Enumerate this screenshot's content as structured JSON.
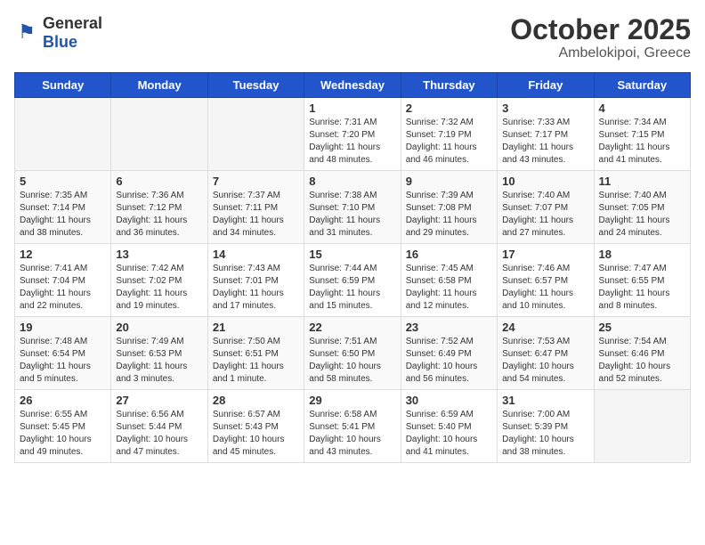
{
  "header": {
    "logo_general": "General",
    "logo_blue": "Blue",
    "title": "October 2025",
    "subtitle": "Ambelokipoi, Greece"
  },
  "weekdays": [
    "Sunday",
    "Monday",
    "Tuesday",
    "Wednesday",
    "Thursday",
    "Friday",
    "Saturday"
  ],
  "weeks": [
    [
      {
        "day": "",
        "sunrise": "",
        "sunset": "",
        "daylight": ""
      },
      {
        "day": "",
        "sunrise": "",
        "sunset": "",
        "daylight": ""
      },
      {
        "day": "",
        "sunrise": "",
        "sunset": "",
        "daylight": ""
      },
      {
        "day": "1",
        "sunrise": "Sunrise: 7:31 AM",
        "sunset": "Sunset: 7:20 PM",
        "daylight": "Daylight: 11 hours and 48 minutes."
      },
      {
        "day": "2",
        "sunrise": "Sunrise: 7:32 AM",
        "sunset": "Sunset: 7:19 PM",
        "daylight": "Daylight: 11 hours and 46 minutes."
      },
      {
        "day": "3",
        "sunrise": "Sunrise: 7:33 AM",
        "sunset": "Sunset: 7:17 PM",
        "daylight": "Daylight: 11 hours and 43 minutes."
      },
      {
        "day": "4",
        "sunrise": "Sunrise: 7:34 AM",
        "sunset": "Sunset: 7:15 PM",
        "daylight": "Daylight: 11 hours and 41 minutes."
      }
    ],
    [
      {
        "day": "5",
        "sunrise": "Sunrise: 7:35 AM",
        "sunset": "Sunset: 7:14 PM",
        "daylight": "Daylight: 11 hours and 38 minutes."
      },
      {
        "day": "6",
        "sunrise": "Sunrise: 7:36 AM",
        "sunset": "Sunset: 7:12 PM",
        "daylight": "Daylight: 11 hours and 36 minutes."
      },
      {
        "day": "7",
        "sunrise": "Sunrise: 7:37 AM",
        "sunset": "Sunset: 7:11 PM",
        "daylight": "Daylight: 11 hours and 34 minutes."
      },
      {
        "day": "8",
        "sunrise": "Sunrise: 7:38 AM",
        "sunset": "Sunset: 7:10 PM",
        "daylight": "Daylight: 11 hours and 31 minutes."
      },
      {
        "day": "9",
        "sunrise": "Sunrise: 7:39 AM",
        "sunset": "Sunset: 7:08 PM",
        "daylight": "Daylight: 11 hours and 29 minutes."
      },
      {
        "day": "10",
        "sunrise": "Sunrise: 7:40 AM",
        "sunset": "Sunset: 7:07 PM",
        "daylight": "Daylight: 11 hours and 27 minutes."
      },
      {
        "day": "11",
        "sunrise": "Sunrise: 7:40 AM",
        "sunset": "Sunset: 7:05 PM",
        "daylight": "Daylight: 11 hours and 24 minutes."
      }
    ],
    [
      {
        "day": "12",
        "sunrise": "Sunrise: 7:41 AM",
        "sunset": "Sunset: 7:04 PM",
        "daylight": "Daylight: 11 hours and 22 minutes."
      },
      {
        "day": "13",
        "sunrise": "Sunrise: 7:42 AM",
        "sunset": "Sunset: 7:02 PM",
        "daylight": "Daylight: 11 hours and 19 minutes."
      },
      {
        "day": "14",
        "sunrise": "Sunrise: 7:43 AM",
        "sunset": "Sunset: 7:01 PM",
        "daylight": "Daylight: 11 hours and 17 minutes."
      },
      {
        "day": "15",
        "sunrise": "Sunrise: 7:44 AM",
        "sunset": "Sunset: 6:59 PM",
        "daylight": "Daylight: 11 hours and 15 minutes."
      },
      {
        "day": "16",
        "sunrise": "Sunrise: 7:45 AM",
        "sunset": "Sunset: 6:58 PM",
        "daylight": "Daylight: 11 hours and 12 minutes."
      },
      {
        "day": "17",
        "sunrise": "Sunrise: 7:46 AM",
        "sunset": "Sunset: 6:57 PM",
        "daylight": "Daylight: 11 hours and 10 minutes."
      },
      {
        "day": "18",
        "sunrise": "Sunrise: 7:47 AM",
        "sunset": "Sunset: 6:55 PM",
        "daylight": "Daylight: 11 hours and 8 minutes."
      }
    ],
    [
      {
        "day": "19",
        "sunrise": "Sunrise: 7:48 AM",
        "sunset": "Sunset: 6:54 PM",
        "daylight": "Daylight: 11 hours and 5 minutes."
      },
      {
        "day": "20",
        "sunrise": "Sunrise: 7:49 AM",
        "sunset": "Sunset: 6:53 PM",
        "daylight": "Daylight: 11 hours and 3 minutes."
      },
      {
        "day": "21",
        "sunrise": "Sunrise: 7:50 AM",
        "sunset": "Sunset: 6:51 PM",
        "daylight": "Daylight: 11 hours and 1 minute."
      },
      {
        "day": "22",
        "sunrise": "Sunrise: 7:51 AM",
        "sunset": "Sunset: 6:50 PM",
        "daylight": "Daylight: 10 hours and 58 minutes."
      },
      {
        "day": "23",
        "sunrise": "Sunrise: 7:52 AM",
        "sunset": "Sunset: 6:49 PM",
        "daylight": "Daylight: 10 hours and 56 minutes."
      },
      {
        "day": "24",
        "sunrise": "Sunrise: 7:53 AM",
        "sunset": "Sunset: 6:47 PM",
        "daylight": "Daylight: 10 hours and 54 minutes."
      },
      {
        "day": "25",
        "sunrise": "Sunrise: 7:54 AM",
        "sunset": "Sunset: 6:46 PM",
        "daylight": "Daylight: 10 hours and 52 minutes."
      }
    ],
    [
      {
        "day": "26",
        "sunrise": "Sunrise: 6:55 AM",
        "sunset": "Sunset: 5:45 PM",
        "daylight": "Daylight: 10 hours and 49 minutes."
      },
      {
        "day": "27",
        "sunrise": "Sunrise: 6:56 AM",
        "sunset": "Sunset: 5:44 PM",
        "daylight": "Daylight: 10 hours and 47 minutes."
      },
      {
        "day": "28",
        "sunrise": "Sunrise: 6:57 AM",
        "sunset": "Sunset: 5:43 PM",
        "daylight": "Daylight: 10 hours and 45 minutes."
      },
      {
        "day": "29",
        "sunrise": "Sunrise: 6:58 AM",
        "sunset": "Sunset: 5:41 PM",
        "daylight": "Daylight: 10 hours and 43 minutes."
      },
      {
        "day": "30",
        "sunrise": "Sunrise: 6:59 AM",
        "sunset": "Sunset: 5:40 PM",
        "daylight": "Daylight: 10 hours and 41 minutes."
      },
      {
        "day": "31",
        "sunrise": "Sunrise: 7:00 AM",
        "sunset": "Sunset: 5:39 PM",
        "daylight": "Daylight: 10 hours and 38 minutes."
      },
      {
        "day": "",
        "sunrise": "",
        "sunset": "",
        "daylight": ""
      }
    ]
  ]
}
